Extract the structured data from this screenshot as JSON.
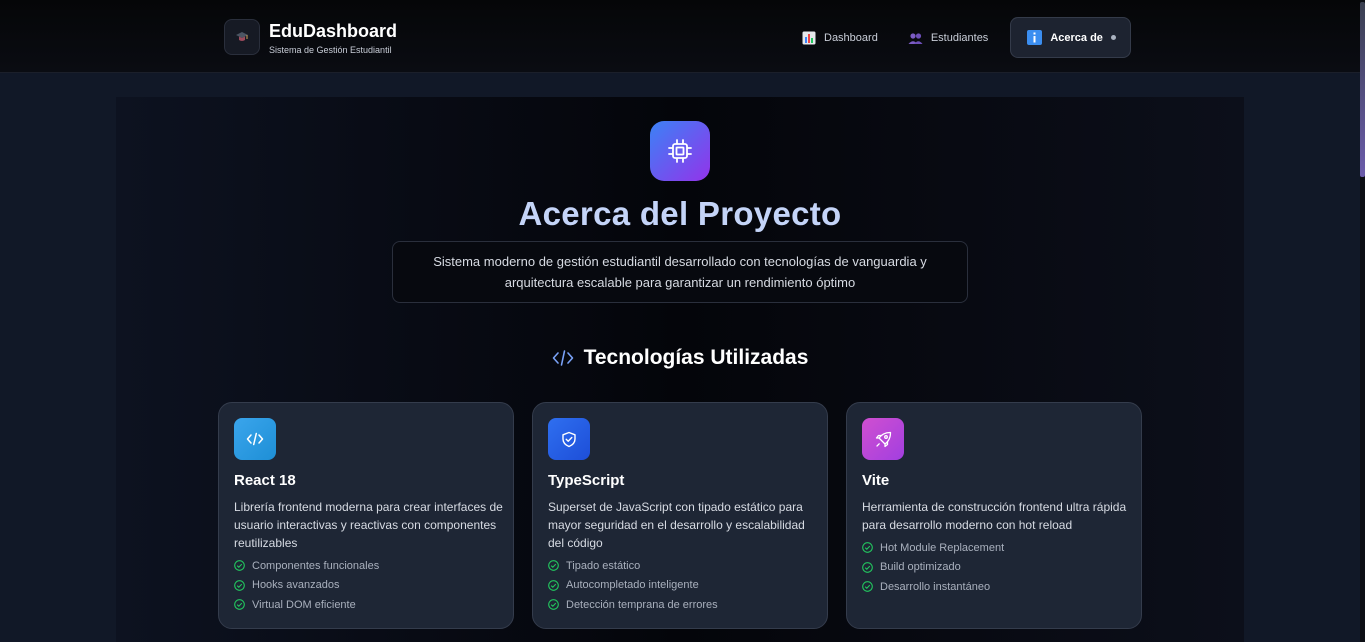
{
  "brand": {
    "title": "EduDashboard",
    "subtitle": "Sistema de Gestión Estudiantil",
    "logo_icon": "graduation-cap-icon"
  },
  "nav": {
    "items": [
      {
        "label": "Dashboard",
        "icon": "bar-chart-icon",
        "active": false
      },
      {
        "label": "Estudiantes",
        "icon": "users-icon",
        "active": false
      },
      {
        "label": "Acerca de",
        "icon": "info-icon",
        "active": true
      }
    ]
  },
  "hero": {
    "icon": "cpu-chip-icon",
    "title": "Acerca del Proyecto",
    "description_line1": "Sistema moderno de gestión estudiantil desarrollado con tecnologías de vanguardia y",
    "description_line2": "arquitectura escalable para garantizar un rendimiento óptimo"
  },
  "technologies": {
    "section_title": "Tecnologías Utilizadas",
    "section_icon": "code-icon",
    "cards": [
      {
        "name": "React 18",
        "icon": "code-icon",
        "accent": "#2f9ce0",
        "description": "Librería frontend moderna para crear interfaces de usuario interactivas y reactivas con componentes reutilizables",
        "features": [
          "Componentes funcionales",
          "Hooks avanzados",
          "Virtual DOM eficiente"
        ]
      },
      {
        "name": "TypeScript",
        "icon": "shield-check-icon",
        "accent": "#2563eb",
        "description": "Superset de JavaScript con tipado estático para mayor seguridad en el desarrollo y escalabilidad del código",
        "features": [
          "Tipado estático",
          "Autocompletado inteligente",
          "Detección temprana de errores"
        ]
      },
      {
        "name": "Vite",
        "icon": "rocket-icon",
        "accent": "#c04ad8",
        "description": "Herramienta de construcción frontend ultra rápida para desarrollo moderno con hot reload",
        "features": [
          "Hot Module Replacement",
          "Build optimizado",
          "Desarrollo instantáneo"
        ]
      }
    ]
  },
  "colors": {
    "check": "#22c55e",
    "hero_gradient_start": "#3b82f6",
    "hero_gradient_end": "#9333ea"
  }
}
